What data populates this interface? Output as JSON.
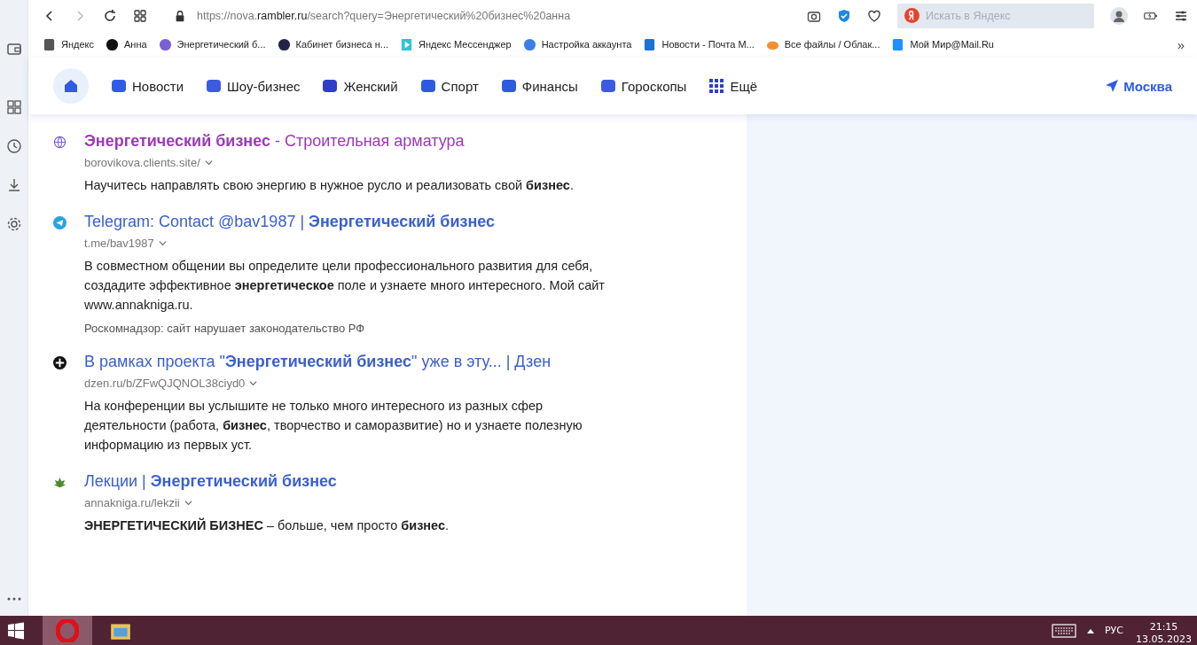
{
  "toolbar": {
    "url_prefix": "https://nova.",
    "url_host": "rambler.ru",
    "url_path": "/search?query=Энергетический%20бизнес%20анна",
    "search_placeholder": "Искать в Яндекс"
  },
  "bookmarks": [
    {
      "label": "Яндекс",
      "kind": "page"
    },
    {
      "label": "Анна",
      "kind": "dark"
    },
    {
      "label": "Энергетический б...",
      "kind": "globe"
    },
    {
      "label": "Кабинет бизнеса н...",
      "kind": "ya"
    },
    {
      "label": "Яндекс Мессенджер",
      "kind": "play"
    },
    {
      "label": "Настройка аккаунта",
      "kind": "circle"
    },
    {
      "label": "Новости - Почта М...",
      "kind": "mail"
    },
    {
      "label": "Все файлы / Облак...",
      "kind": "cloud"
    },
    {
      "label": "Мой Мир@Mail.Ru",
      "kind": "smile"
    }
  ],
  "bookmarks_more": "»",
  "nav": {
    "items": [
      {
        "label": "Новости",
        "kind": "news"
      },
      {
        "label": "Шоу-бизнес",
        "kind": "mic"
      },
      {
        "label": "Женский",
        "kind": "crown"
      },
      {
        "label": "Спорт",
        "kind": "ball"
      },
      {
        "label": "Финансы",
        "kind": "bag"
      },
      {
        "label": "Гороскопы",
        "kind": "star"
      },
      {
        "label": "Ещё",
        "kind": "grid"
      }
    ],
    "location": "Москва"
  },
  "results": [
    {
      "kind": "globe",
      "visited": true,
      "title": "**Энергетический бизнес** - Строительная арматура",
      "url": "borovikova.clients.site/",
      "snippet": "Научитесь направлять свою энергию в нужное русло и реализовать свой **бизнес**."
    },
    {
      "kind": "telegram",
      "visited": false,
      "title": "Telegram: Contact @bav1987 | **Энергетический бизнес**",
      "url": "t.me/bav1987",
      "snippet": "В совместном общении вы определите цели профессионального развития для себя, создадите эффективное **энергетическое** поле и узнаете много интересного. Мой сайт www.annakniga.ru.",
      "note": "Роскомнадзор: сайт нарушает законодательство РФ"
    },
    {
      "kind": "dzen",
      "visited": false,
      "title": "В рамках проекта \"**Энергетический бизнес**\" уже в эту... | Дзен",
      "url": "dzen.ru/b/ZFwQJQNOL38ciyd0",
      "snippet": "На конференции вы услышите не только много интересного из разных сфер деятельности (работа, **бизнес**, творчество и саморазвитие) но и узнаете полезную информацию из первых уст."
    },
    {
      "kind": "leaf",
      "visited": false,
      "title": "Лекции | **Энергетический бизнес**",
      "url": "annakniga.ru/lekzii",
      "snippet": "**ЭНЕРГЕТИЧЕСКИЙ БИЗНЕС** – больше, чем просто **бизнес**."
    }
  ],
  "taskbar": {
    "language": "РУС",
    "time": "21:15",
    "date": "13.05.2023"
  }
}
